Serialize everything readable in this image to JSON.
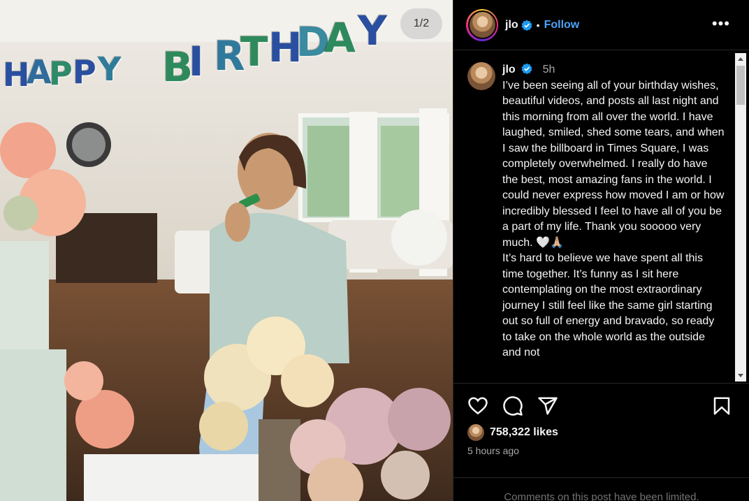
{
  "media": {
    "counter": "1/2",
    "banner": [
      "H",
      "A",
      "P",
      "P",
      "Y",
      "B",
      "I",
      "R",
      "T",
      "H",
      "D",
      "A",
      "Y"
    ]
  },
  "post": {
    "username": "jlo",
    "verified": true,
    "follow_label": "Follow",
    "dot": "•",
    "more_label": "•••",
    "caption_time": "5h",
    "caption_paragraphs": [
      "I’ve been seeing all of your birthday wishes, beautiful videos, and posts all last night and this morning from all over the world. I have laughed, smiled, shed some tears, and when I saw the billboard in Times Square, I was completely overwhelmed. I really do have the best, most amazing fans in the world. I could never express how moved I am or how incredibly blessed I feel to have all of you be a part of my life. Thank you sooooo very much. 🤍🙏🏼",
      "It’s hard to believe we have spent all this time together. It’s funny as I sit here contemplating on the most extraordinary journey I still feel like the same girl starting out so full of energy and bravado, so ready to take on the whole world as the outside and not"
    ],
    "likes": "758,322 likes",
    "posted_ago": "5 hours ago",
    "comments_notice": "Comments on this post have been limited."
  },
  "icons": [
    "heart-icon",
    "comment-icon",
    "share-icon",
    "bookmark-icon",
    "more-icon",
    "verified-icon"
  ],
  "colors": {
    "accent": "#4ea2f5",
    "background": "#000000",
    "muted": "#a8a8a8",
    "verified": "#1d9bf0"
  }
}
